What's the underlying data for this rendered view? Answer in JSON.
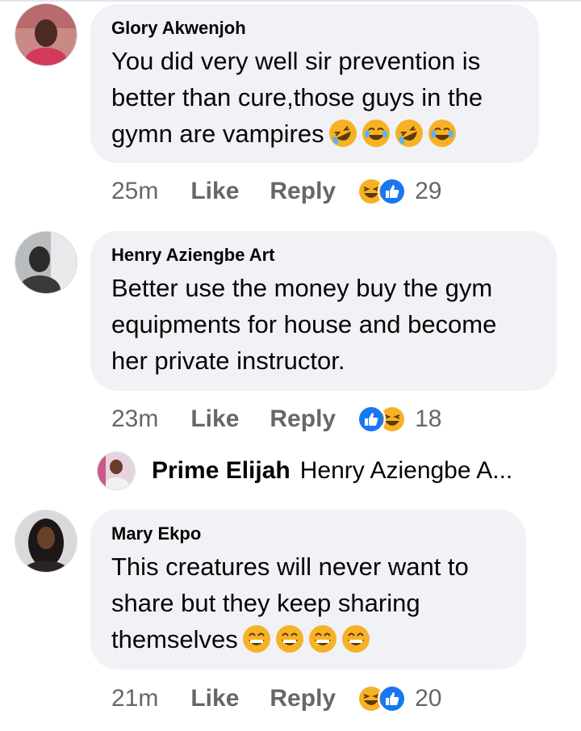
{
  "comments": [
    {
      "author": "Glory Akwenjoh",
      "text": "You did very well sir prevention is better than cure,those guys in the gymn are vampires",
      "emojis": [
        "rofl-emoji",
        "joy-emoji",
        "rofl-emoji",
        "joy-emoji"
      ],
      "time": "25m",
      "like_label": "Like",
      "reply_label": "Reply",
      "reaction_icons": [
        "haha",
        "like"
      ],
      "reaction_count": "29"
    },
    {
      "author": "Henry Aziengbe Art",
      "text": "Better use the money buy the gym equipments for house and become her private instructor.",
      "emojis": [],
      "time": "23m",
      "like_label": "Like",
      "reply_label": "Reply",
      "reaction_icons": [
        "like",
        "haha"
      ],
      "reaction_count": "18"
    },
    {
      "author": "Mary Ekpo",
      "text": "This creatures will never want to share but they keep sharing themselves",
      "emojis": [
        "grin-emoji",
        "grin-emoji",
        "grin-emoji",
        "grin-emoji"
      ],
      "time": "21m",
      "like_label": "Like",
      "reply_label": "Reply",
      "reaction_icons": [
        "haha",
        "like"
      ],
      "reaction_count": "20"
    }
  ],
  "reply_preview": {
    "name": "Prime Elijah",
    "text": "Henry Aziengbe A..."
  },
  "colors": {
    "bubble": "#f0f2f5",
    "meta_text": "#65676b",
    "like_blue": "#1877f2",
    "emoji_yellow": "#f7b125"
  }
}
